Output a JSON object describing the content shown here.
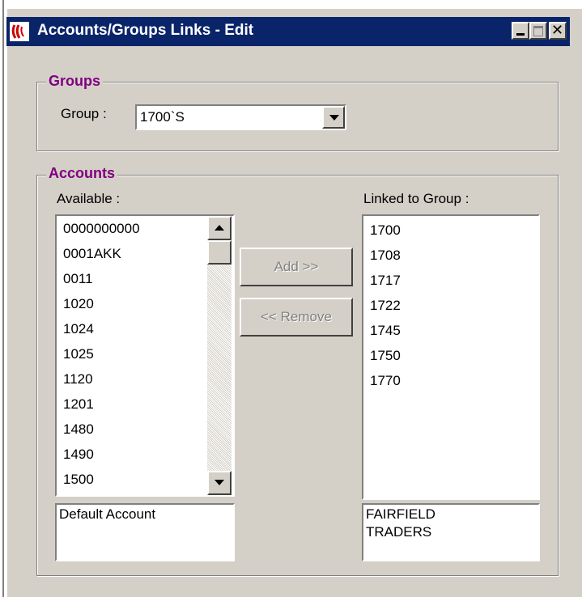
{
  "window": {
    "title": "Accounts/Groups Links - Edit",
    "icon": "app-logo-icon"
  },
  "groups_section": {
    "legend": "Groups",
    "group_label": "Group :",
    "group_value": "1700`S"
  },
  "accounts_section": {
    "legend": "Accounts",
    "available_label": "Available :",
    "available_items": [
      "0000000000",
      "0001AKK",
      "0011",
      "1020",
      "1024",
      "1025",
      "1120",
      "1201",
      "1480",
      "1490",
      "1500"
    ],
    "available_detail": "Default Account",
    "linked_label": "Linked to Group :",
    "linked_items": [
      "1700",
      "1708",
      "1717",
      "1722",
      "1745",
      "1750",
      "1770"
    ],
    "linked_detail_line1": "FAIRFIELD",
    "linked_detail_line2": "TRADERS",
    "add_button": "Add >>",
    "remove_button": "<< Remove"
  },
  "colors": {
    "title_bar": "#0a246a",
    "legend_text": "#800080",
    "window_face": "#d4d0c8"
  }
}
